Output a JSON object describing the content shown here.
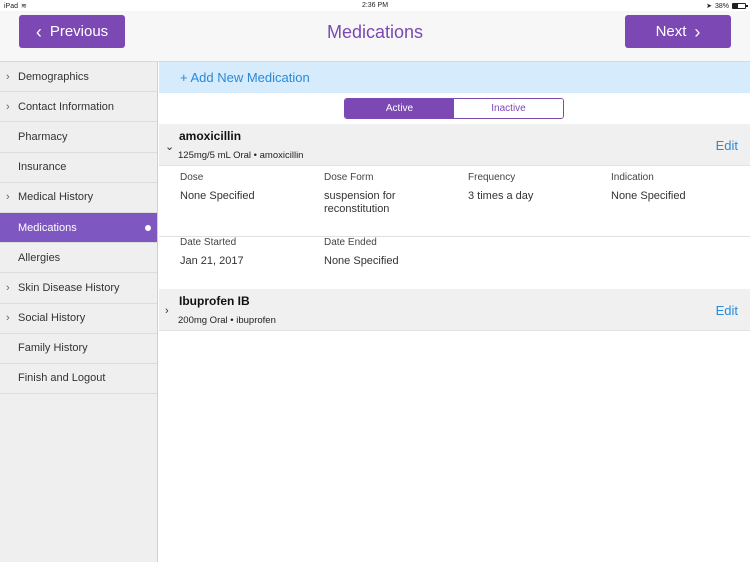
{
  "status_bar": {
    "device": "iPad",
    "time": "2:36 PM",
    "battery": "38%"
  },
  "nav": {
    "previous_label": "Previous",
    "next_label": "Next",
    "title": "Medications"
  },
  "sidebar": {
    "items": [
      {
        "label": "Demographics",
        "chevron": true
      },
      {
        "label": "Contact Information",
        "chevron": true
      },
      {
        "label": "Pharmacy",
        "chevron": false
      },
      {
        "label": "Insurance",
        "chevron": false
      },
      {
        "label": "Medical History",
        "chevron": true
      },
      {
        "label": "Medications",
        "chevron": false,
        "active": true
      },
      {
        "label": "Allergies",
        "chevron": false
      },
      {
        "label": "Skin Disease History",
        "chevron": true
      },
      {
        "label": "Social History",
        "chevron": true
      },
      {
        "label": "Family History",
        "chevron": false
      },
      {
        "label": "Finish and Logout",
        "chevron": false
      }
    ]
  },
  "main": {
    "add_label": "+ Add New Medication",
    "segments": {
      "active": "Active",
      "inactive": "Inactive"
    },
    "medications": [
      {
        "name": "amoxicillin",
        "summary": "125mg/5 mL Oral • amoxicillin",
        "edit": "Edit",
        "expanded": true,
        "details": {
          "dose_label": "Dose",
          "dose": "None Specified",
          "form_label": "Dose Form",
          "form": "suspension for reconstitution",
          "freq_label": "Frequency",
          "freq": "3 times a day",
          "ind_label": "Indication",
          "ind": "None Specified",
          "start_label": "Date Started",
          "start": "Jan 21, 2017",
          "end_label": "Date Ended",
          "end": "None Specified"
        }
      },
      {
        "name": "Ibuprofen IB",
        "summary": "200mg Oral • ibuprofen",
        "edit": "Edit",
        "expanded": false
      }
    ]
  },
  "colors": {
    "accent": "#7b48b4",
    "link": "#2a8ad8",
    "add_bar": "#d6ebfb"
  }
}
